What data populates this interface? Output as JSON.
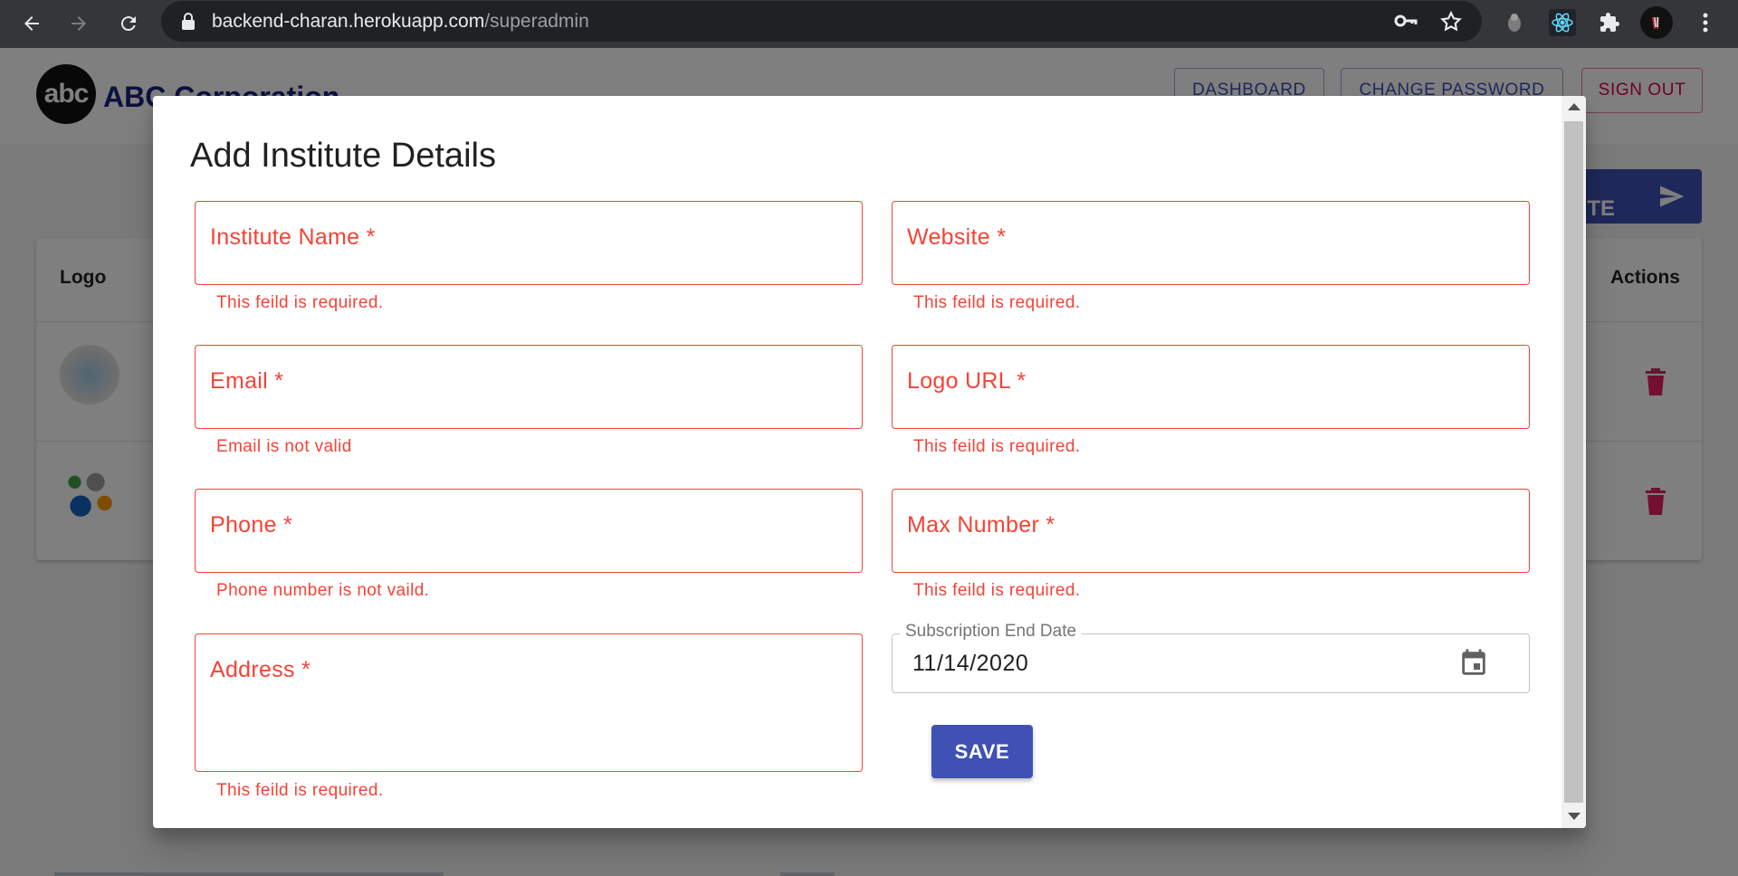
{
  "browser": {
    "url_host": "backend-charan.herokuapp.com",
    "url_path": "/superadmin"
  },
  "app": {
    "logo_text": "abc",
    "brand": "ABC Corporation",
    "nav": {
      "dashboard": "DASHBOARD",
      "change_password": "CHANGE PASSWORD",
      "sign_out": "SIGN OUT"
    },
    "add_button_label": "ADD INSTITUTE",
    "table": {
      "columns": [
        "Logo",
        "Actions"
      ]
    }
  },
  "dialog": {
    "title": "Add Institute Details",
    "fields": {
      "institute_name": {
        "label": "Institute Name *",
        "error": "This feild is required."
      },
      "website": {
        "label": "Website *",
        "error": "This feild is required."
      },
      "email": {
        "label": "Email *",
        "error": "Email is not valid"
      },
      "logo_url": {
        "label": "Logo URL *",
        "error": "This feild is required."
      },
      "phone": {
        "label": "Phone *",
        "error": "Phone number is not vaild."
      },
      "max_number": {
        "label": "Max Number *",
        "error": "This feild is required."
      },
      "address": {
        "label": "Address *",
        "error": "This feild is required."
      }
    },
    "subscription": {
      "label": "Subscription End Date",
      "value": "11/14/2020"
    },
    "save_label": "SAVE"
  },
  "colors": {
    "error": "#f44336",
    "primary": "#3f51b5",
    "secondary": "#dc004e"
  }
}
